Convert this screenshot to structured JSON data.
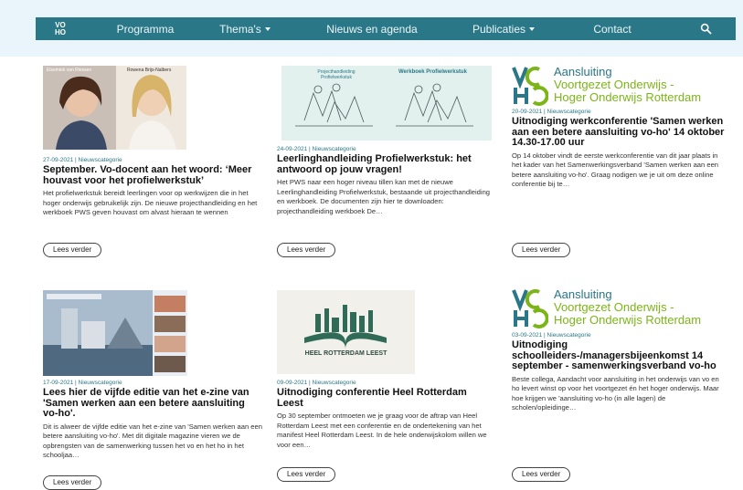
{
  "nav": {
    "logo_top": "VO",
    "logo_bottom": "HO",
    "items": [
      {
        "label": "Programma",
        "has_dropdown": false
      },
      {
        "label": "Thema's",
        "has_dropdown": true
      },
      {
        "label": "Nieuws en agenda",
        "has_dropdown": false
      },
      {
        "label": "Publicaties",
        "has_dropdown": true
      },
      {
        "label": "Contact",
        "has_dropdown": false
      }
    ],
    "search_icon": "search-icon"
  },
  "voho_logo": {
    "line1": "Aansluiting",
    "line2": "Voortgezet Onderwijs -",
    "line3": "Hoger Onderwijs Rotterdam"
  },
  "cards": [
    {
      "meta": "27-09-2021 | Nieuwscategorie",
      "title": "September. Vo-docent aan het woord: ‘Meer houvast voor het profielwerkstuk’",
      "excerpt": "Het profielwerkstuk bereidt leerlingen voor op werkwijzen die in het hoger onderwijs gebruikelijk zijn. De nieuwe projecthandleiding en het werkboek PWS geven houvast om alvast hieraan te wennen",
      "button": "Lees verder",
      "image_caption_left": "Elsemiek van Riessen",
      "image_caption_right": "Rowena Brijs-Nalbers"
    },
    {
      "meta": "24-09-2021 | Nieuwscategorie",
      "title": "Leerlinghandleiding Profielwerkstuk: het antwoord op jouw vragen!",
      "excerpt": "Het PWS naar een hoger niveau tillen kan met de nieuwe Leerlinghandleiding Profielwerkstuk, bestaande uit projecthandleiding en werkboek. De documenten zijn hier te downloaden: projecthandleiding werkboek De…",
      "button": "Lees verder",
      "image_title_left": "Projecthandleiding Profielwerkstuk",
      "image_title_right": "Werkboek Profielwerkstuk"
    },
    {
      "meta": "20-09-2021 | Nieuwscategorie",
      "title": "Uitnodiging werkconferentie 'Samen werken aan een betere aansluiting vo-ho' 14 oktober 14.30-17.00 uur",
      "excerpt": "Op 14 oktober vindt de eerste werkconferentie van dit jaar plaats in het kader van het Samenwerkingsverband 'Samen werken aan een betere aansluiting vo-ho'. Graag nodigen we je uit om deze online conferentie bij te…",
      "button": "Lees verder"
    },
    {
      "meta": "17-09-2021 | Nieuwscategorie",
      "title": "Lees hier de vijfde editie van het e-zine van 'Samen werken aan een betere aansluiting vo-ho'.",
      "excerpt": "Dit is alweer de vijfde editie van het e-zine van 'Samen werken aan een betere aansluiting vo-ho'. Met dit digitale magazine vieren we de opbrengsten van de samenwerking tussen het vo en het ho in het schooljaa…",
      "button": "Lees verder"
    },
    {
      "meta": "09-09-2021 | Nieuwscategorie",
      "title": "Uitnodiging conferentie Heel Rotterdam Leest",
      "excerpt": "Op 30 september ontmoeten we je graag voor de aftrap van Heel Rotterdam Leest met een conferentie en de ondertekening van het manifest Heel Rotterdam Leest. In de hele onderwijskolom willen we voor een…",
      "button": "Lees verder",
      "image_text": "HEEL ROTTERDAM LEEST"
    },
    {
      "meta": "03-09-2021 | Nieuwscategorie",
      "title": "Uitnodiging schoolleiders-/managersbijeenkomst 14 september - samenwerkingsverband vo-ho",
      "excerpt": "Beste collega, Aandacht voor aansluiting in het onderwijs van vo en ho levert winst op voor het voortgezet én het hoger onderwijs. Maar hoe krijgen we 'aansluiting vo-ho (in alle lagen) de scholen/opleidinge…",
      "button": "Lees verder"
    }
  ],
  "colors": {
    "nav_bg": "#2a7788",
    "top_bg": "#eaf5fb",
    "accent_green": "#7cb518",
    "meta_teal": "#2a7788"
  }
}
